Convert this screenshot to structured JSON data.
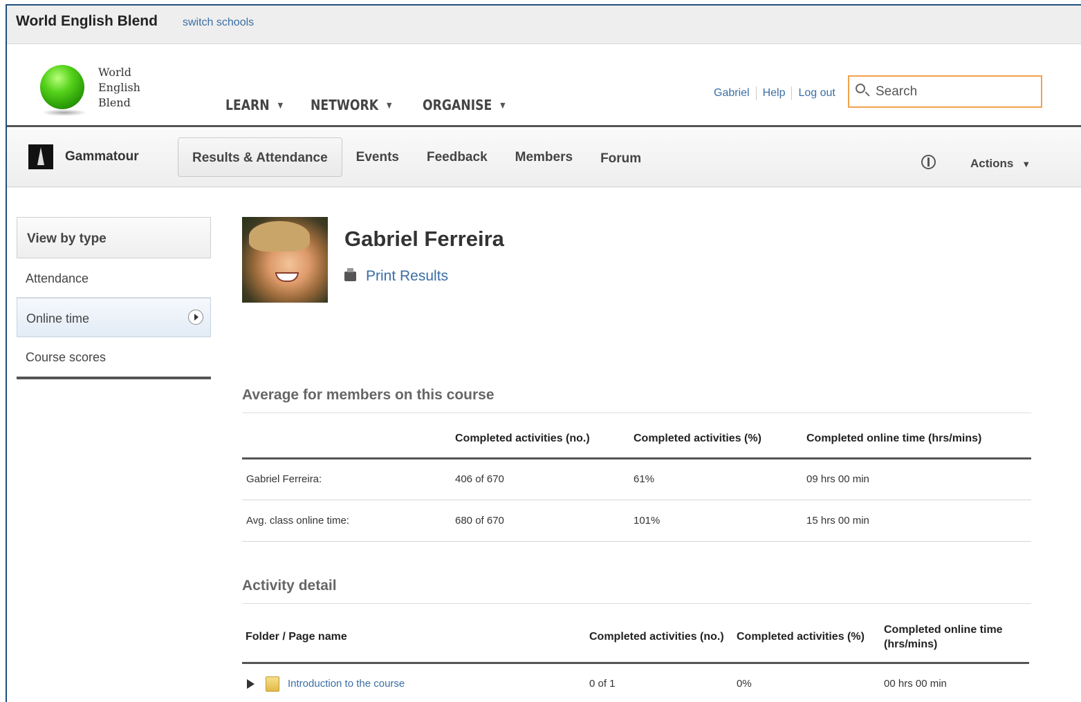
{
  "topbar": {
    "school_name": "World English Blend",
    "switch_link": "switch schools"
  },
  "header": {
    "logo_lines": [
      "World",
      "English",
      "Blend"
    ],
    "nav": [
      {
        "label": "LEARN"
      },
      {
        "label": "NETWORK"
      },
      {
        "label": "ORGANISE"
      }
    ],
    "user_links": [
      "Gabriel",
      "Help",
      "Log out"
    ],
    "search_placeholder": "Search",
    "search_value": ""
  },
  "coursebar": {
    "course_name": "Gammatour",
    "tabs": [
      "Results & Attendance",
      "Events",
      "Feedback",
      "Members",
      "Forum"
    ],
    "active_tab": "Results & Attendance",
    "actions_label": "Actions"
  },
  "sidebar": {
    "heading": "View by type",
    "items": [
      "Attendance",
      "Online time",
      "Course scores"
    ],
    "active_item": "Online time"
  },
  "profile": {
    "name": "Gabriel Ferreira",
    "print_label": "Print Results"
  },
  "average_section": {
    "title": "Average for members on this course",
    "headers": [
      "",
      "Completed activities (no.)",
      "Completed activities (%)",
      "Completed online time (hrs/mins)"
    ],
    "rows": [
      [
        "Gabriel Ferreira:",
        "406 of 670",
        "61%",
        "09 hrs 00 min"
      ],
      [
        "Avg. class online time:",
        "680 of 670",
        "101%",
        "15 hrs 00 min"
      ]
    ]
  },
  "activity_section": {
    "title": "Activity detail",
    "headers": [
      "Folder / Page name",
      "Completed activities (no.)",
      "Completed activities (%)",
      "Completed online time (hrs/mins)"
    ],
    "rows": [
      [
        "Introduction to the course",
        "0 of 1",
        "0%",
        "00 hrs 00 min"
      ]
    ]
  }
}
